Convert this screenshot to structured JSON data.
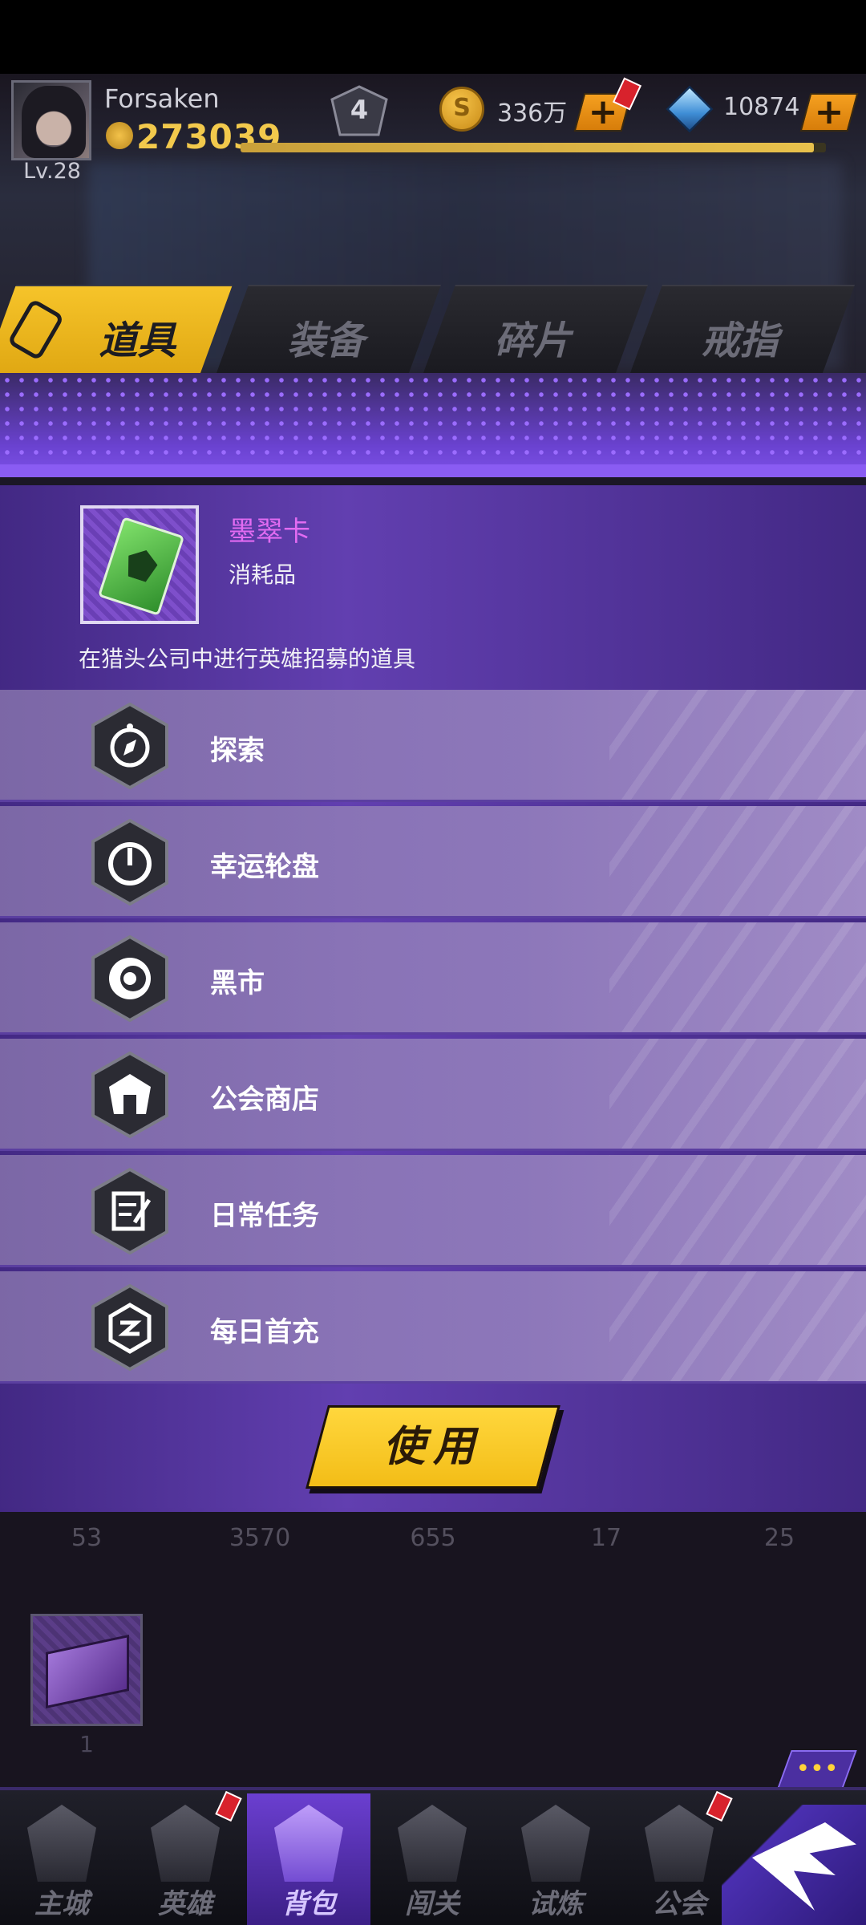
{
  "player": {
    "name": "Forsaken",
    "level": "Lv.28",
    "power": "273039",
    "rank": "4",
    "xp_fraction": 0.98
  },
  "currency": {
    "coins": "336万",
    "gems": "10874",
    "plus": "+"
  },
  "tabs": [
    {
      "label": "道具",
      "active": true
    },
    {
      "label": "装备",
      "active": false
    },
    {
      "label": "碎片",
      "active": false
    },
    {
      "label": "戒指",
      "active": false
    }
  ],
  "item": {
    "name": "墨翠卡",
    "type": "消耗品",
    "description": "在猎头公司中进行英雄招募的道具",
    "name_color": "#e26bf2"
  },
  "sources": [
    {
      "label": "探索",
      "icon": "compass-icon"
    },
    {
      "label": "幸运轮盘",
      "icon": "wheel-icon"
    },
    {
      "label": "黑市",
      "icon": "vortex-icon"
    },
    {
      "label": "公会商店",
      "icon": "guild-shop-icon"
    },
    {
      "label": "日常任务",
      "icon": "task-icon"
    },
    {
      "label": "每日首充",
      "icon": "recharge-icon"
    }
  ],
  "use_button": "使用",
  "inventory": {
    "counts": [
      "53",
      "3570",
      "655",
      "17",
      "25"
    ],
    "slot_count": "1"
  },
  "chat": {
    "icon": "chat-icon",
    "glyph": "•••"
  },
  "nav": [
    {
      "label": "主城",
      "active": false
    },
    {
      "label": "英雄",
      "active": false
    },
    {
      "label": "背包",
      "active": true
    },
    {
      "label": "闯关",
      "active": false
    },
    {
      "label": "试炼",
      "active": false
    },
    {
      "label": "公会",
      "active": false
    }
  ],
  "colors": {
    "accent_yellow": "#f3bd17",
    "panel_purple": "#6e46c8",
    "alert_red": "#d8222c"
  }
}
